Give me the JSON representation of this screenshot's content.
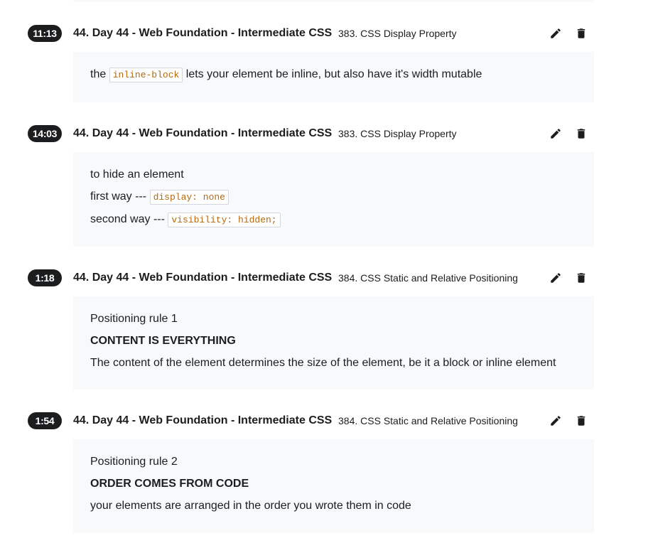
{
  "icons": {
    "edit": "pencil-icon",
    "delete": "trash-icon"
  },
  "colors": {
    "badge_bg": "#1c1d1f",
    "note_bg": "#f7f9fa",
    "code_text": "#b4690e"
  },
  "notes": [
    {
      "time": "11:13",
      "section": "44. Day 44 - Web Foundation - Intermediate CSS",
      "lecture": "383. CSS Display Property",
      "body": {
        "l1_pre": "the",
        "l1_code": "inline-block",
        "l1_post": "lets your element be inline, but also have it's width mutable"
      }
    },
    {
      "time": "14:03",
      "section": "44. Day 44 - Web Foundation - Intermediate CSS",
      "lecture": "383. CSS Display Property",
      "body": {
        "l1": "to hide an element",
        "l2_pre": "first way ---",
        "l2_code": "display: none",
        "l3_pre": "second way ---",
        "l3_code": "visibility: hidden;"
      }
    },
    {
      "time": "1:18",
      "section": "44. Day 44 - Web Foundation - Intermediate CSS",
      "lecture": "384. CSS Static and Relative Positioning",
      "body": {
        "l1": "Positioning rule 1",
        "l2": "CONTENT IS EVERYTHING",
        "l3": "The content of the element determines the size of the element, be it a block or inline element"
      }
    },
    {
      "time": "1:54",
      "section": "44. Day 44 - Web Foundation - Intermediate CSS",
      "lecture": "384. CSS Static and Relative Positioning",
      "body": {
        "l1": "Positioning rule 2",
        "l2": "ORDER COMES FROM CODE",
        "l3": "your elements are arranged in the order you wrote them in code"
      }
    }
  ]
}
